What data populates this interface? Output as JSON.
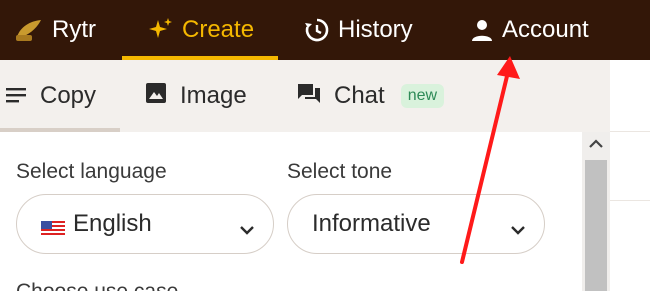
{
  "nav": {
    "brand": "Rytr",
    "create": "Create",
    "history": "History",
    "account": "Account",
    "colors": {
      "bar": "#331708",
      "active": "#f5b800"
    }
  },
  "tabs": [
    {
      "label": "Copy",
      "icon": "lines-icon"
    },
    {
      "label": "Image",
      "icon": "image-icon"
    },
    {
      "label": "Chat",
      "icon": "chat-icon",
      "badge": "new"
    }
  ],
  "form": {
    "language_label": "Select language",
    "language_value": "English",
    "tone_label": "Select tone",
    "tone_value": "Informative",
    "use_case_label": "Choose use case"
  },
  "annotation": {
    "arrow_color": "#ff1a1a"
  }
}
